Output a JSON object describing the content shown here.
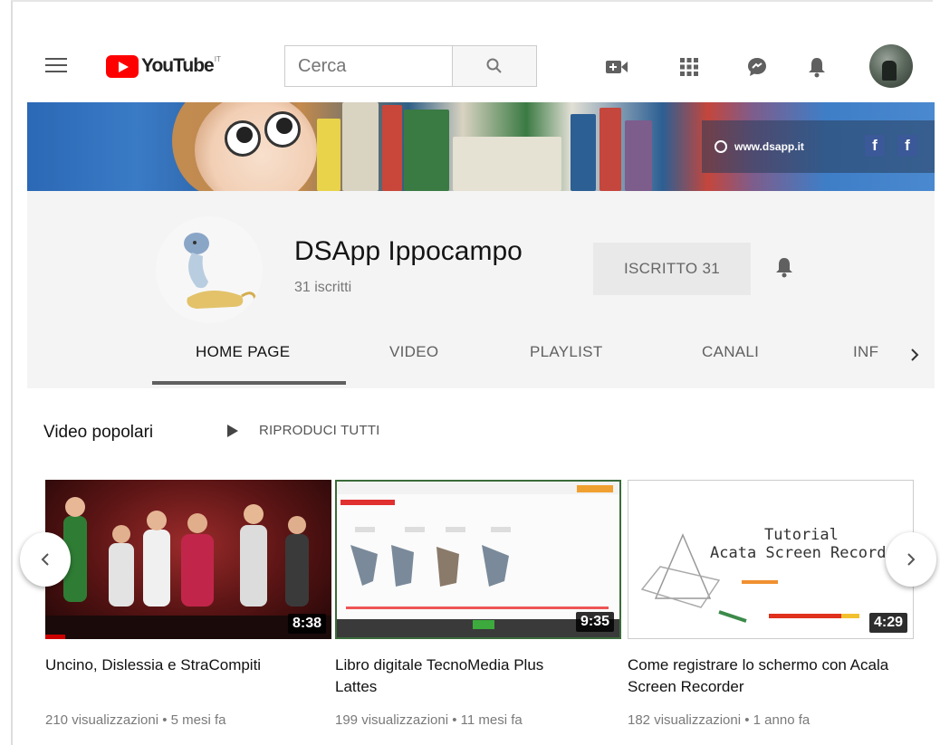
{
  "header": {
    "logo_text": "YouTube",
    "logo_country": "IT",
    "search_placeholder": "Cerca"
  },
  "banner": {
    "link_text": "www.dsapp.it",
    "fb_glyph": "f"
  },
  "channel": {
    "name": "DSApp Ippocampo",
    "subscribers": "31 iscritti",
    "subscribe_label": "ISCRITTO  31"
  },
  "tabs": [
    {
      "label": "HOME PAGE",
      "active": true
    },
    {
      "label": "VIDEO"
    },
    {
      "label": "PLAYLIST"
    },
    {
      "label": "CANALI"
    },
    {
      "label": "INF"
    }
  ],
  "section": {
    "title": "Video popolari",
    "play_all_label": "RIPRODUCI TUTTI"
  },
  "videos": [
    {
      "title": "Uncino, Dislessia e StraCompiti",
      "duration": "8:38",
      "meta": "210 visualizzazioni • 5 mesi fa",
      "watched": 0.07
    },
    {
      "title": "Libro digitale TecnoMedia Plus Lattes",
      "duration": "9:35",
      "meta": "199 visualizzazioni • 11 mesi fa"
    },
    {
      "title": "Come registrare lo schermo con Acala Screen Recorder",
      "duration": "4:29",
      "meta": "182 visualizzazioni • 1 anno fa",
      "thumb_text_1": "Tutorial",
      "thumb_text_2": "Acata Screen Recorder"
    }
  ],
  "colors": {
    "brand_red": "#ff0000",
    "progress_red": "#cc0000"
  }
}
